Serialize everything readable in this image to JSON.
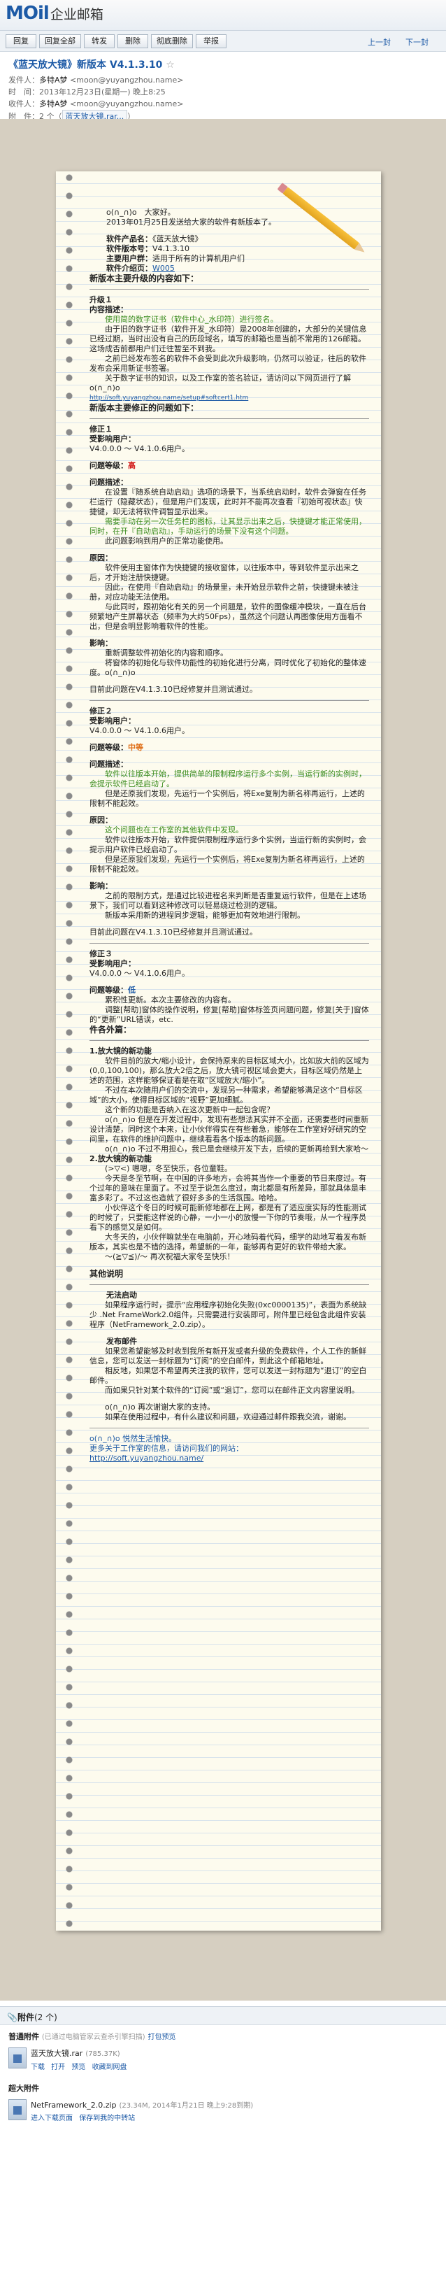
{
  "app": {
    "logo": "MOil",
    "brand": "企业邮箱"
  },
  "toolbar": {
    "reply": "回复",
    "reply_all": "回复全部",
    "forward": "转发",
    "delete": "删除",
    "delete_forever": "彻底删除",
    "junk": "举报",
    "prev": "上一封",
    "next": "下一封"
  },
  "mail": {
    "subject": "《蓝天放大镜》新版本 V4.1.3.10",
    "subject_star": "☆",
    "sender_label": "发件人：",
    "sender_name": "多特A梦",
    "sender_email": "<moon@yuyangzhou.name>",
    "time_label": "时　间：",
    "time": "2013年12月23日(星期一) 晚上8:25",
    "to_label": "收件人：",
    "to_name": "多特A梦",
    "to_email": "<moon@yuyangzhou.name>",
    "att_label": "附　件：",
    "att_count": "2 个（",
    "att_chip": "蓝天放大镜.rar..."
  },
  "letter": {
    "greeting": "o(∩_∩)o　大家好。",
    "greeting2": "2013年01月25日发送给大家的软件有新版本了。",
    "product_label": "软件产品名：",
    "product": "《蓝天放大镜》",
    "version_label": "软件版本号：",
    "version": "V4.1.3.10",
    "users_label": "主要用户群：",
    "users": "适用于所有的计算机用户们",
    "intro_label": "软件介绍页：",
    "intro_link": "W005",
    "upgrade_title": "新版本主要升级的内容如下：",
    "upgrade1": "升级１",
    "upgrade1_content_label": "内容描述：",
    "upgrade1_p1": "使用简的数字证书（软件中心_水印符）进行签名。",
    "upgrade1_p2": "由于旧的数字证书（软件开发_水印符）是2008年创建的，大部分的关键信息已经过期，当时出没有自己的历段域名，填写的邮箱也是当前不常用的126邮箱。这场成否前都用户们迁往暂至不到我。",
    "upgrade1_p3": "之前已经发布签名的软件不会受到此次升级影响，仍然可以验证，往后的软件发布会采用新证书签署。",
    "upgrade1_p4": "关于数字证书的知识，以及工作室的签名验证，请访问以下网页进行了解 o(∩_∩)o",
    "upgrade1_link": "http://soft.yuyangzhou.name/setup#softcert1.htm",
    "fix_title": "新版本主要修正的问题如下：",
    "fix1": "修正１",
    "affected_label": "受影响用户：",
    "fix1_users": "V4.0.0.0 ～ V4.1.0.6用户。",
    "level_label": "问题等级：",
    "fix1_level": "高",
    "desc_label": "问题描述：",
    "fix1_p1": "在设置『随系统自动启动』选项的场景下，当系统启动时，软件会弹窗在任务栏运行（隐藏状态），但是用户们发现，此时并不能再次查看『初始可视状态』快捷键，却无法将软件调暂显示出来。",
    "fix1_p2": "需要手动在另一次任务栏的图标，让其显示出来之后，快捷键才能正常使用，同时，在开『自动启动』，手动运行的场景下没有这个问题。",
    "fix1_p3": "此问题影响到用户的正常功能使用。",
    "reason_label": "原因：",
    "fix1_r1": "软件使用主窗体作为快捷键的接收窗体，以往版本中，等到软件显示出来之后，才开始注册快捷键。",
    "fix1_r2": "因此，在使用『自动启动』的场景里，未开始显示软件之前，快捷键未被注册，对应功能无法使用。",
    "fix1_r3": "与此同时，跟初始化有关的另一个问题是，软件的图像缓冲模块，一直在后台频繁地产生屏幕状态（频率为大约50Fps），虽然这个问题认再图像使用方面看不出，但是会明显影响着软件的性能。",
    "measure_label": "影响：",
    "fix1_m1": "重新调整软件初始化的内容和顺序。",
    "fix1_m2": "将窗体的初始化与软件功能性的初始化进行分离，同时优化了初始化的整体速度。o(∩_∩)o",
    "fix1_status": "目前此问题在V4.1.3.10已经修复并且测试通过。",
    "fix2": "修正２",
    "fix2_users": "V4.0.0.0 ～ V4.1.0.6用户。",
    "fix2_level": "中等",
    "fix2_p1": "软件以往版本开始，提供简单的限制程序运行多个实例，当运行新的实例时，会提示软件已经启动了。",
    "fix2_p2": "但是还原我们发现，先运行一个实例后，将Exe复制为新名称再运行，上述的限制不能起效。",
    "fix2_r0": "这个问题也在工作室的其他软件中发现。",
    "fix2_r1": "软件以往版本开始，软件提供限制程序运行多个实例，当运行新的实例时，会提示用户软件已经启动了。",
    "fix2_r2": "但是还原我们发现，先运行一个实例后，将Exe复制为新名称再运行，上述的限制不能起效。",
    "fix2_m1": "之前的限制方式，是通过比较进程名来判断是否重复运行软件，但是在上述场景下，我们可以看到这种修改可以轻易绕过检测的逻辑。",
    "fix2_m2": "新版本采用新的进程同步逻辑，能够更加有效地进行限制。",
    "fix2_status": "目前此问题在V4.1.3.10已经修复并且测试通过。",
    "fix3": "修正３",
    "fix3_users": "V4.0.0.0 ～ V4.1.0.6用户。",
    "fix3_level": "低",
    "fix3_p1": "累积性更新。本次主要修改的内容有。",
    "fix3_p2": "调整[帮助]窗体的操作说明，修复[帮助]窗体标签页问题问题，修复[关于]窗体的“更新”URL错误，etc.",
    "extra_title": "件各外篇：",
    "extra1": "1.放大镜的新功能",
    "extra1_p1": "软件目前的放大/缩小设计，会保持原来的目标区域大小，比如放大前的区域为(0,0,100,100)，那么放大2倍之后，放大镜可视区域会更大，目标区域仍然是上述的范围，这样能够保证看是在取“区域放大/缩小”。",
    "extra1_p2": "不过在本次随用户们的交流中，发现另一种需求，希望能够满足这个“目标区域”的大小，使得目标区域的“视野”更加细腻。",
    "extra1_p3": "这个新的功能是否纳入在这次更新中一起包含呢？",
    "extra1_p4": "o(∩_∩)o 但是在开发过程中，发现有些想法其实并不全面，还需要些时间重新设计清楚，同时这个本来，让小伙伴得实在有些着急，能够在工作室好好研究的空间里，在软件的维护问题中，继续看看各个版本的新问题。",
    "extra1_p5": "o(∩_∩)o 不过不用担心，我已是会继续开发下去，后续的更新再给到大家哈～",
    "extra2": "2.放大镜的新功能",
    "extra2_p1": "(>▽<) 嗯嗯，冬至快乐，各位童鞋。",
    "extra2_p2": "今天是冬至节啊，在中国的许多地方，会将其当作一个重要的节日来度过。有个过年的意味在里面了。不过至于说怎么度过，南北都是有所差异，那就具体是丰富多彩了。不过这也造就了很好多多的生活氛围。哈哈。",
    "extra2_p3": "小伙伴这个冬日的时候可能新修地都在上网，都是有了适应度实际的性能测试的时候了，只要能这样说的心静，一小一小的放慢一下你的节奏哦，从一个程序员看下的感觉又是如何。",
    "extra2_p4": "大冬天的，小伙伴嘛就坐在电脑前，开心地码着代码，细学的动地写着发布新版本，其实也是不错的选择，希望新的一年，能够再有更好的软件带给大家。",
    "extra2_p5": "～(≧▽≦)/～ 再次祝福大家冬至快乐！",
    "other_title": "其他说明",
    "o1": "无法启动",
    "o1_p1": "如果程序运行时，提示“应用程序初始化失败(0xc0000135)”，表面为系统缺少 .Net FrameWork2.0组件，只需要进行安装即可，附件里已经包含此组件安装程序（NetFramework_2.0.zip）。",
    "o2": "发布邮件",
    "o2_p1": "如果您希望能够及时收到我所有新开发或者升级的免费软件，个人工作的新鲜信息，您可以发送一封标题为“订阅”的空白邮件，到此这个邮箱地址。",
    "o2_p2": "相反地，如果您不希望再关注我的软件，您可以发送一封标题为“退订”的空白邮件。",
    "o2_p3": "而如果只针对某个软件的“订阅”或“退订”，您可以在邮件正文内容里说明。",
    "o3_p1": "o(∩_∩)o 再次谢谢大家的支持。",
    "o3_p2": "如果在使用过程中，有什么建议和问题，欢迎通过邮件跟我交流，谢谢。",
    "sign1": "o(∩_∩)o  悦然生活愉快。",
    "sign2": "更多关于工作室的信息，请访问我们的网站：",
    "sign_link": "http://soft.yuyangzhou.name/"
  },
  "attachments": {
    "header": "附件",
    "header_count": "(2 个)",
    "normal_label": "普通附件",
    "normal_note": "(已通过电脑管家云查杀引擎扫描)",
    "normal_preview": "打包预览",
    "file1_name": "蓝天放大镜.rar",
    "file1_size": "(785.37K)",
    "file1_actions": [
      "下载",
      "打开",
      "预览",
      "收藏到网盘"
    ],
    "big_label": "超大附件",
    "file2_name": "NetFramework_2.0.zip",
    "file2_size": "(23.34M, 2014年1月21日 晚上9:28到期)",
    "file2_actions": [
      "进入下载页面",
      "保存到我的中转站"
    ]
  }
}
